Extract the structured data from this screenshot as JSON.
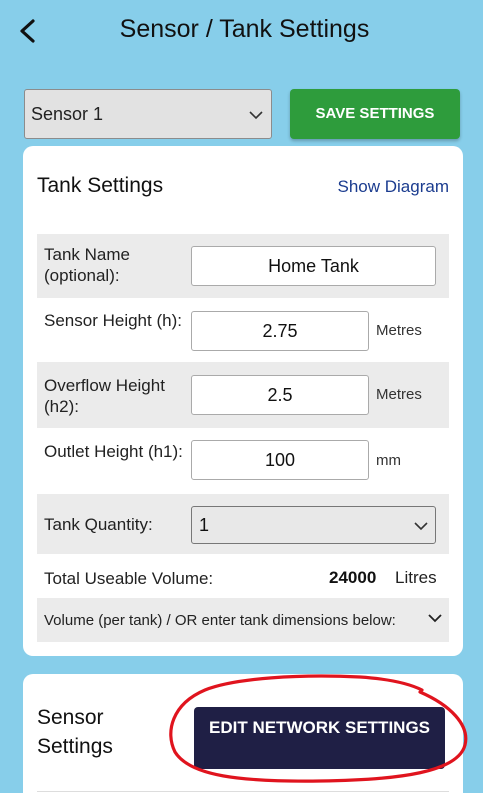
{
  "header": {
    "title": "Sensor / Tank Settings",
    "back_icon": "chevron-left-icon"
  },
  "toolbar": {
    "sensor_select": {
      "selected": "Sensor 1"
    },
    "save_label": "SAVE SETTINGS"
  },
  "tank_settings": {
    "title": "Tank Settings",
    "show_diagram": "Show Diagram",
    "tank_name": {
      "label": "Tank Name (optional):",
      "value": "Home Tank"
    },
    "sensor_height": {
      "label": "Sensor Height (h):",
      "value": "2.75",
      "unit": "Metres"
    },
    "overflow_height": {
      "label": "Overflow Height (h2):",
      "value": "2.5",
      "unit": "Metres"
    },
    "outlet_height": {
      "label": "Outlet Height (h1):",
      "value": "100",
      "unit": "mm"
    },
    "tank_quantity": {
      "label": "Tank Quantity:",
      "selected": "1"
    },
    "total_volume": {
      "label": "Total Useable Volume:",
      "value": "24000",
      "unit": "Litres"
    },
    "dimensions_toggle": "Volume (per tank) / OR enter tank dimensions below:"
  },
  "sensor_settings": {
    "title": "Sensor Settings",
    "edit_network_label": "EDIT NETWORK SETTINGS"
  },
  "colors": {
    "background": "#87ceea",
    "save_button": "#2e9c3c",
    "edit_button": "#1f1f45",
    "link": "#1b3c8f",
    "annotation": "#e0141e"
  }
}
